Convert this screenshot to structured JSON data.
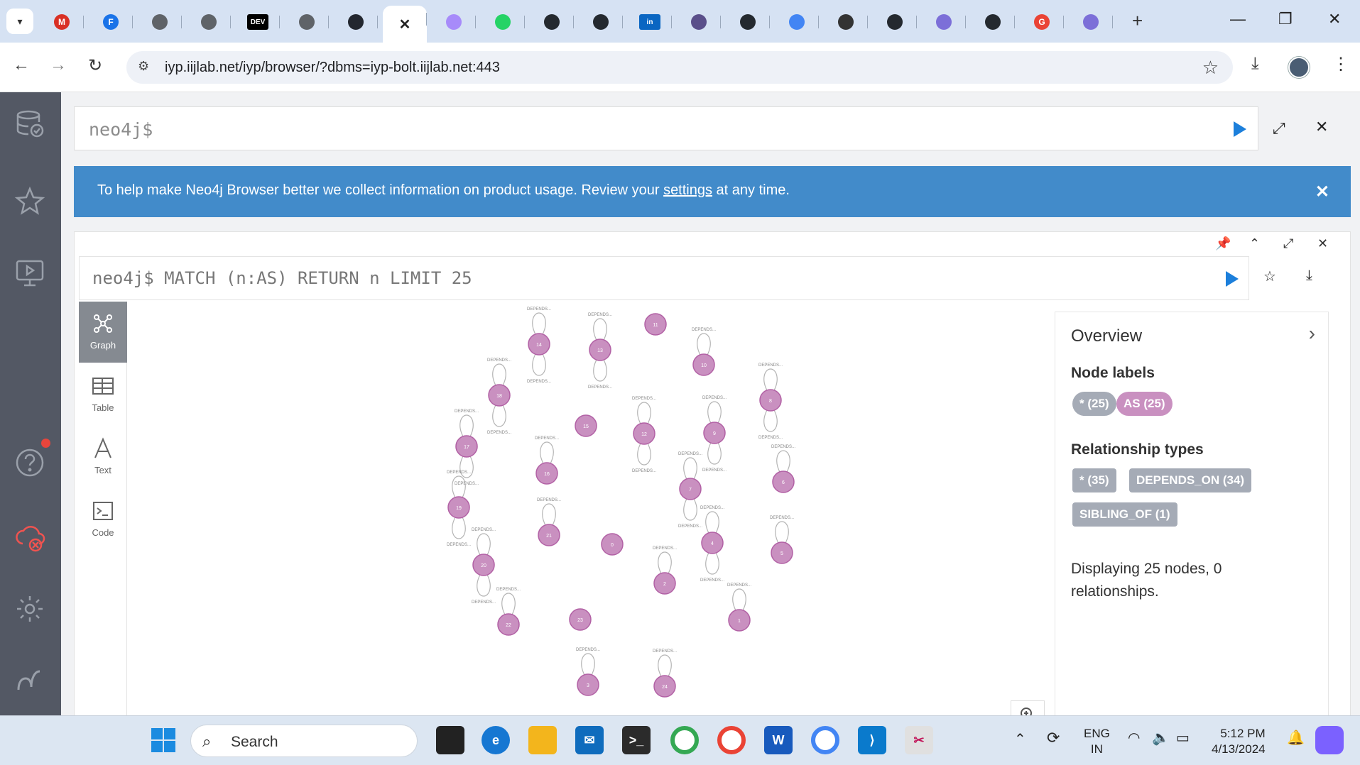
{
  "browser": {
    "url": "iyp.iijlab.net/iyp/browser/?dbms=iyp-bolt.iijlab.net:443",
    "tabs": [
      {
        "icon": "gmail-icon",
        "letter": "M",
        "color": "#d93025"
      },
      {
        "icon": "forms-icon",
        "letter": "F",
        "color": "#1a73e8"
      },
      {
        "icon": "globe-icon",
        "letter": "",
        "color": "#5f6368"
      },
      {
        "icon": "chrome-icon",
        "letter": "",
        "color": "#5f6368"
      },
      {
        "icon": "dev-icon",
        "letter": "DEV",
        "color": "#000000"
      },
      {
        "icon": "globe-icon",
        "letter": "",
        "color": "#5f6368"
      },
      {
        "icon": "react-icon",
        "letter": "",
        "color": "#23272f"
      },
      {
        "icon": "close-tab-icon",
        "letter": "",
        "color": "#ffffff"
      },
      {
        "icon": "ai-icon",
        "letter": "",
        "color": "#a78bfa"
      },
      {
        "icon": "whatsapp-icon",
        "letter": "",
        "color": "#25d366"
      },
      {
        "icon": "github-icon",
        "letter": "",
        "color": "#24292f"
      },
      {
        "icon": "github-icon",
        "letter": "",
        "color": "#24292f"
      },
      {
        "icon": "linkedin-icon",
        "letter": "in",
        "color": "#0a66c2"
      },
      {
        "icon": "cat-icon",
        "letter": "",
        "color": "#5a4f8a"
      },
      {
        "icon": "github-icon",
        "letter": "",
        "color": "#24292f"
      },
      {
        "icon": "boat-icon",
        "letter": "",
        "color": "#4285f4"
      },
      {
        "icon": "doc-icon",
        "letter": "",
        "color": "#333333"
      },
      {
        "icon": "github-icon",
        "letter": "",
        "color": "#24292f"
      },
      {
        "icon": "ai-icon",
        "letter": "",
        "color": "#7c6fd8"
      },
      {
        "icon": "github-icon",
        "letter": "",
        "color": "#24292f"
      },
      {
        "icon": "google-icon",
        "letter": "G",
        "color": "#ea4335"
      },
      {
        "icon": "ai-icon",
        "letter": "",
        "color": "#7c6fd8"
      }
    ]
  },
  "editor": {
    "prompt": "neo4j$"
  },
  "banner": {
    "text_before": "To help make Neo4j Browser better we collect information on product usage. Review your ",
    "link": "settings",
    "text_after": " at any time."
  },
  "frame": {
    "query": "neo4j$ MATCH (n:AS) RETURN n LIMIT 25"
  },
  "viewbar": {
    "graph": "Graph",
    "table": "Table",
    "text": "Text",
    "code": "Code"
  },
  "overview": {
    "title": "Overview",
    "node_labels_heading": "Node labels",
    "node_labels": [
      {
        "label": "* (25)",
        "color": "#a5abb6"
      },
      {
        "label": "AS (25)",
        "color": "#c990c0"
      }
    ],
    "rel_types_heading": "Relationship types",
    "rel_types": [
      {
        "label": "* (35)",
        "color": "#a5abb6"
      },
      {
        "label": "DEPENDS_ON (34)",
        "color": "#a5abb6"
      },
      {
        "label": "SIBLING_OF (1)",
        "color": "#a5abb6"
      }
    ],
    "status": "Displaying 25 nodes, 0 relationships."
  },
  "graph": {
    "node_color": "#c990c0",
    "loop_label": "DEPENDS...",
    "nodes": [
      {
        "id": "14",
        "loops": "both"
      },
      {
        "id": "13",
        "loops": "both"
      },
      {
        "id": "11",
        "loops": "none"
      },
      {
        "id": "10",
        "loops": "top"
      },
      {
        "id": "18",
        "loops": "both"
      },
      {
        "id": "8",
        "loops": "both"
      },
      {
        "id": "15",
        "loops": "none"
      },
      {
        "id": "12",
        "loops": "both"
      },
      {
        "id": "9",
        "loops": "both"
      },
      {
        "id": "17",
        "loops": "both"
      },
      {
        "id": "16",
        "loops": "top"
      },
      {
        "id": "7",
        "loops": "both"
      },
      {
        "id": "6",
        "loops": "top"
      },
      {
        "id": "19",
        "loops": "both"
      },
      {
        "id": "21",
        "loops": "top"
      },
      {
        "id": "0",
        "loops": "none"
      },
      {
        "id": "4",
        "loops": "both"
      },
      {
        "id": "5",
        "loops": "top"
      },
      {
        "id": "20",
        "loops": "both"
      },
      {
        "id": "2",
        "loops": "top"
      },
      {
        "id": "22",
        "loops": "top"
      },
      {
        "id": "23",
        "loops": "none"
      },
      {
        "id": "1",
        "loops": "top"
      },
      {
        "id": "3",
        "loops": "top"
      },
      {
        "id": "24",
        "loops": "top"
      }
    ]
  },
  "taskbar": {
    "search_placeholder": "Search",
    "lang_top": "ENG",
    "lang_bottom": "IN",
    "time": "5:12 PM",
    "date": "4/13/2024"
  }
}
